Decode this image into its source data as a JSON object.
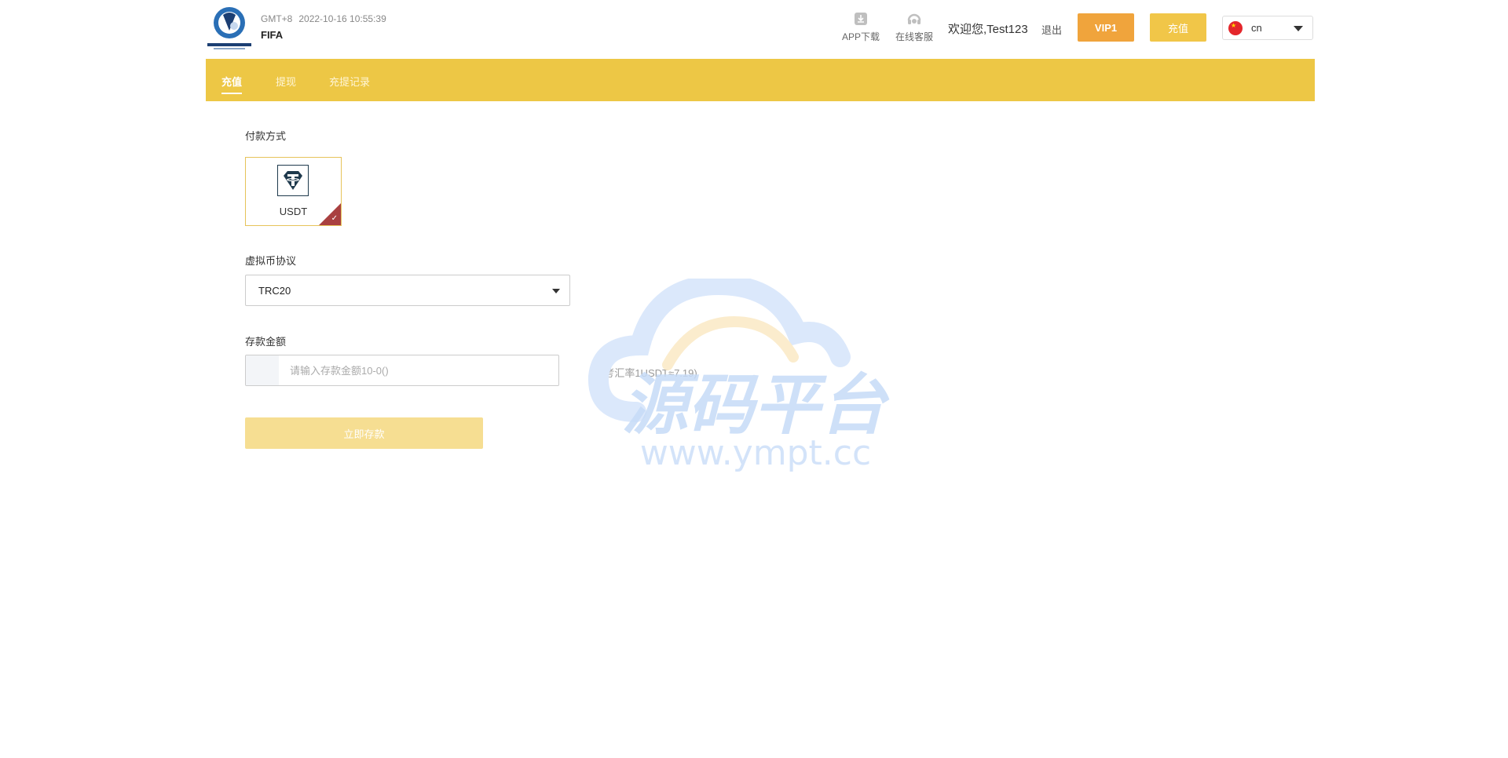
{
  "header": {
    "logo_icon": "fifa-football-logo",
    "timezone": "GMT+8",
    "datetime": "2022-10-16 10:55:39",
    "site_name": "FIFA",
    "app_download_label": "APP下载",
    "app_download_icon": "download-icon",
    "customer_service_label": "在线客服",
    "customer_service_icon": "headset-icon",
    "welcome_text": "欢迎您,Test123",
    "logout_label": "退出",
    "vip_label": "VIP1",
    "recharge_label": "充值",
    "language": {
      "code": "cn",
      "flag_icon": "china-flag-icon"
    }
  },
  "nav": {
    "tabs": [
      {
        "label": "充值",
        "active": true
      },
      {
        "label": "提现",
        "active": false
      },
      {
        "label": "充提记录",
        "active": false
      }
    ]
  },
  "form": {
    "payment_method_label": "付款方式",
    "payment_methods": [
      {
        "name": "USDT",
        "icon": "tether-icon",
        "selected": true
      }
    ],
    "protocol_label": "虚拟币协议",
    "protocol_value": "TRC20",
    "amount_label": "存款金额",
    "amount_placeholder": "请输入存款金额10-0()",
    "amount_value": "",
    "rate_text": "(参考汇率1USDT≈7.19)",
    "submit_label": "立即存款"
  },
  "watermark": {
    "title": "源码平台",
    "url": "www.ympt.cc"
  },
  "colors": {
    "nav_bg": "#edc745",
    "vip_bg": "#f0a43c",
    "recharge_bg": "#f1c648",
    "submit_bg_disabled": "#f6de92",
    "selected_corner": "#a94040"
  }
}
